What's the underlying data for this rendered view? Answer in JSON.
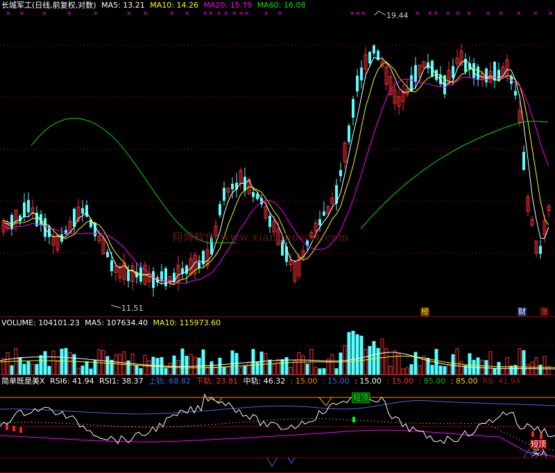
{
  "main_header": {
    "name": "长城军工(日线,前复权,对数)",
    "ma5": "MA5: 13.21",
    "ma10": "MA10: 14.26",
    "ma20": "MA20: 15.79",
    "ma60": "MA60: 16.08"
  },
  "price_labels": {
    "high": "19.44",
    "low": "11.51"
  },
  "event_markers": [
    "榜",
    "财",
    "涨"
  ],
  "watermark": "翔博软件 www.xiangbosoft.com",
  "volume_header": {
    "volume": "VOLUME: 104101.23",
    "ma5": "MA5: 107634.40",
    "ma10": "MA10: 115973.60"
  },
  "indicator_header": {
    "name": "简单既是美X",
    "rsi6": "RSI6: 41.94",
    "rsi1": "RSI1: 38.37",
    "upper": "上轨: 68.82",
    "lower": "下轨: 23.81",
    "mid": "中轨: 46.32",
    "levels": [
      ": 15.00",
      ": 15.00",
      ": 15.00",
      ": 15.00",
      ": 85.00",
      ": 85.00"
    ],
    "extra": "RB: 41.94"
  },
  "indicator_labels": {
    "short_top": "短顶",
    "long_top": "短顶",
    "buy": "买入"
  },
  "colors": {
    "up": "#ff3232",
    "down": "#54ffff",
    "ma5": "#ffffff",
    "ma10": "#ffff00",
    "ma20": "#ff00ff",
    "ma60": "#00e600",
    "grid": "#8b0000"
  }
}
